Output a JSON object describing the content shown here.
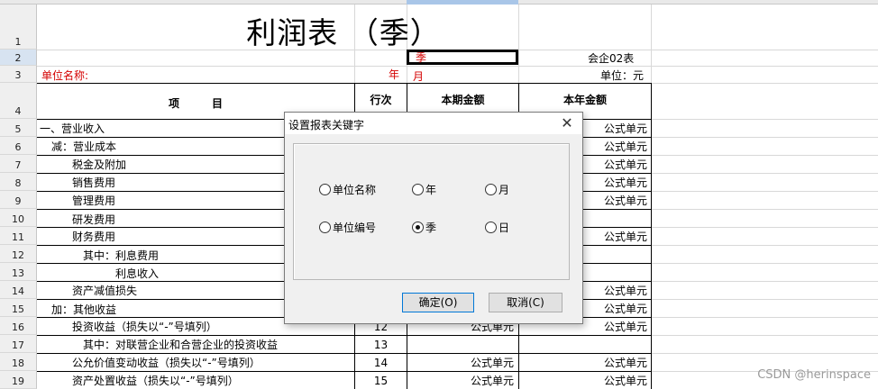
{
  "report": {
    "title": "利润表  （季）",
    "quarter_cell": "季",
    "form_no": "会企02表",
    "unit_name_label": "单位名称:",
    "year_label": "年",
    "month_label": "月",
    "currency_label": "单位：元",
    "headers": {
      "item": "项　　　目",
      "line_no": "行次",
      "current": "本期金额",
      "ytd": "本年金额"
    }
  },
  "row_numbers": [
    "1",
    "2",
    "3",
    "4",
    "5",
    "6",
    "7",
    "8",
    "9",
    "10",
    "11",
    "12",
    "13",
    "14",
    "15",
    "16",
    "17",
    "18",
    "19"
  ],
  "rows": [
    {
      "label": "一、营业收入",
      "line": "",
      "cur": "",
      "ytd": "公式单元"
    },
    {
      "label": "减：营业成本",
      "line": "",
      "cur": "",
      "ytd": "公式单元"
    },
    {
      "label": "税金及附加",
      "line": "",
      "cur": "",
      "ytd": "公式单元"
    },
    {
      "label": "销售费用",
      "line": "",
      "cur": "",
      "ytd": "公式单元"
    },
    {
      "label": "管理费用",
      "line": "",
      "cur": "",
      "ytd": "公式单元"
    },
    {
      "label": "研发费用",
      "line": "",
      "cur": "",
      "ytd": ""
    },
    {
      "label": "财务费用",
      "line": "",
      "cur": "",
      "ytd": "公式单元"
    },
    {
      "label": "其中：利息费用",
      "line": "",
      "cur": "",
      "ytd": ""
    },
    {
      "label": "利息收入",
      "line": "",
      "cur": "",
      "ytd": ""
    },
    {
      "label": "资产减值损失",
      "line": "",
      "cur": "",
      "ytd": "公式单元"
    },
    {
      "label": "加：其他收益",
      "line": "",
      "cur": "",
      "ytd": "公式单元"
    },
    {
      "label": "投资收益（损失以“-”号填列）",
      "line": "12",
      "cur": "公式单元",
      "ytd": "公式单元"
    },
    {
      "label": "其中：对联营企业和合营企业的投资收益",
      "line": "13",
      "cur": "",
      "ytd": ""
    },
    {
      "label": "公允价值变动收益（损失以“-”号填列）",
      "line": "14",
      "cur": "公式单元",
      "ytd": "公式单元"
    },
    {
      "label": "资产处置收益（损失以“-”号填列）",
      "line": "15",
      "cur": "公式单元",
      "ytd": "公式单元"
    }
  ],
  "dialog": {
    "title": "设置报表关键字",
    "close": "✕",
    "options": {
      "unit_name": "单位名称",
      "year": "年",
      "month": "月",
      "unit_code": "单位编号",
      "quarter": "季",
      "day": "日"
    },
    "selected": "quarter",
    "ok": "确定(O)",
    "cancel": "取消(C)"
  },
  "watermark": "CSDN @herinspace"
}
